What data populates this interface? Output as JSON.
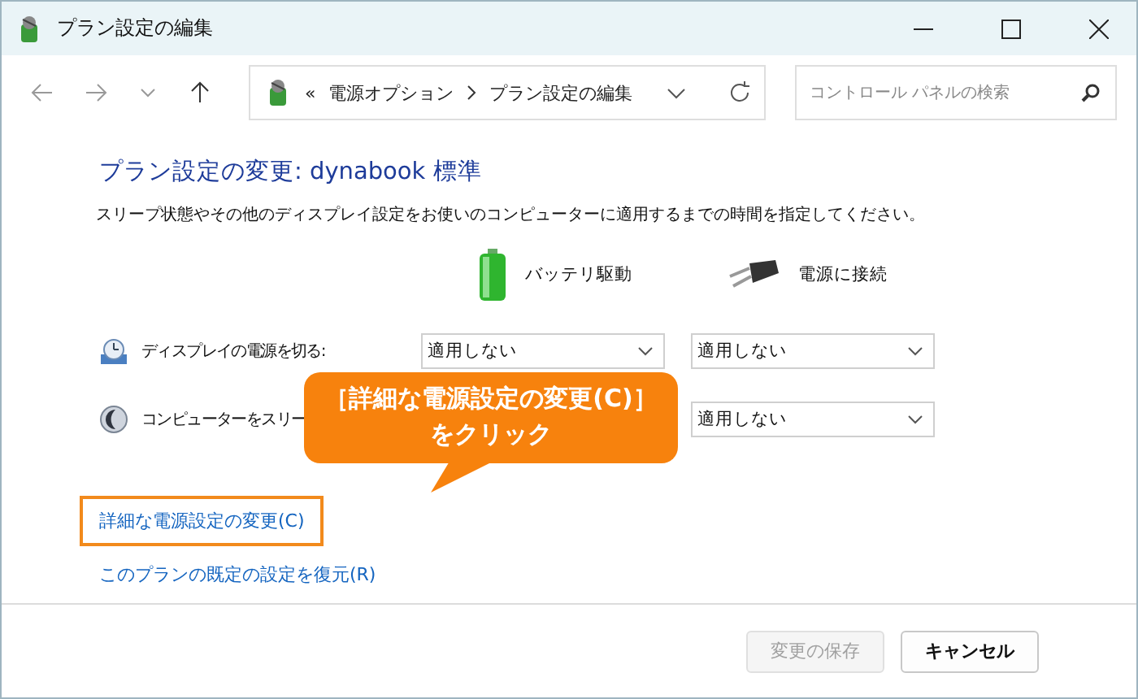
{
  "window": {
    "title": "プラン設定の編集"
  },
  "address": {
    "overflow": "«",
    "breadcrumb": [
      "電源オプション",
      "プラン設定の編集"
    ]
  },
  "search": {
    "placeholder": "コントロール パネルの検索"
  },
  "heading": "プラン設定の変更: dynabook 標準",
  "description": "スリープ状態やその他のディスプレイ設定をお使いのコンピューターに適用するまでの時間を指定してください。",
  "columns": [
    {
      "kind": "battery",
      "label": "バッテリ駆動"
    },
    {
      "kind": "plugged",
      "label": "電源に接続"
    }
  ],
  "settings": [
    {
      "kind": "display",
      "label": "ディスプレイの電源を切る:",
      "battery": "適用しない",
      "plugged": "適用しない"
    },
    {
      "kind": "sleep",
      "label": "コンピューターをスリー",
      "plugged": "適用しない"
    }
  ],
  "links": [
    {
      "text": "詳細な電源設定の変更(C)",
      "highlighted": true
    },
    {
      "text": "このプランの既定の設定を復元(R)",
      "highlighted": false
    }
  ],
  "buttons": [
    {
      "label": "変更の保存",
      "disabled": true
    },
    {
      "label": "キャンセル",
      "disabled": false
    }
  ],
  "callout": {
    "lines": [
      "［詳細な電源設定の変更(C)］",
      "をクリック"
    ]
  }
}
